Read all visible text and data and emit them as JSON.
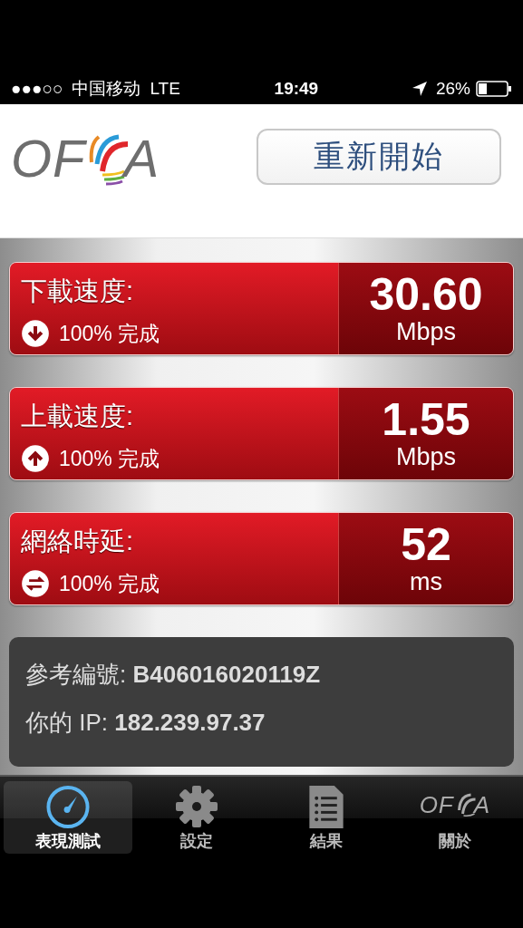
{
  "status_bar": {
    "signal": "●●●○○",
    "carrier": "中国移动",
    "network": "LTE",
    "time": "19:49",
    "battery": "26%"
  },
  "header": {
    "logo": {
      "left": "OF",
      "right": "A"
    },
    "restart_button": "重新開始"
  },
  "results": [
    {
      "kind": "download",
      "label": "下載速度:",
      "progress": "100% 完成",
      "value": "30.60",
      "unit": "Mbps"
    },
    {
      "kind": "upload",
      "label": "上載速度:",
      "progress": "100% 完成",
      "value": "1.55",
      "unit": "Mbps"
    },
    {
      "kind": "latency",
      "label": "網絡時延:",
      "progress": "100% 完成",
      "value": "52",
      "unit": "ms"
    }
  ],
  "info": [
    {
      "label": "參考編號:",
      "value": "B406016020119Z"
    },
    {
      "label": "你的 IP:",
      "value": "182.239.97.37"
    }
  ],
  "tabs": [
    {
      "kind": "gauge",
      "label": "表現測試",
      "selected": true
    },
    {
      "kind": "gear",
      "label": "設定",
      "selected": false
    },
    {
      "kind": "document",
      "label": "結果",
      "selected": false
    },
    {
      "kind": "logo",
      "label": "關於",
      "selected": false,
      "logo": {
        "left": "OF",
        "right": "A"
      }
    }
  ]
}
